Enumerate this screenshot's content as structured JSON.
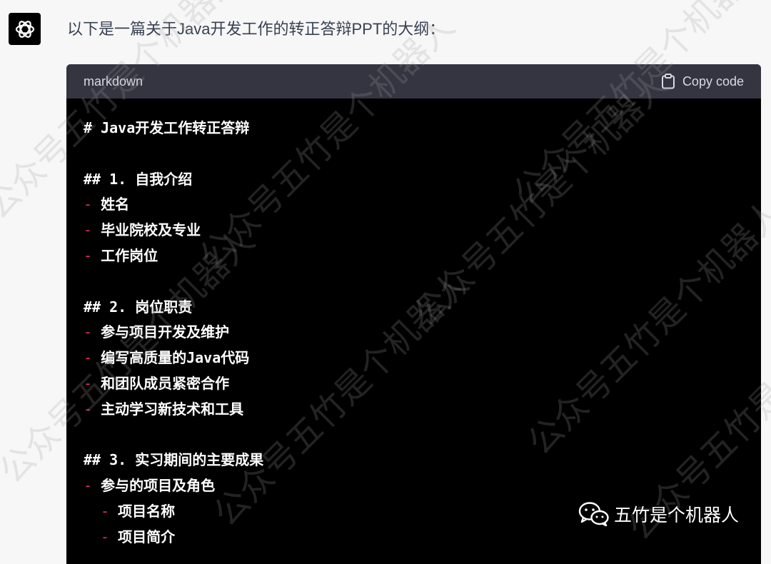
{
  "message": {
    "intro": "以下是一篇关于Java开发工作的转正答辩PPT的大纲："
  },
  "code_block": {
    "language": "markdown",
    "copy_label": "Copy code",
    "lines": [
      {
        "bullet": "",
        "indent": 0,
        "text": "# Java开发工作转正答辩"
      },
      {
        "bullet": "",
        "indent": 0,
        "text": ""
      },
      {
        "bullet": "",
        "indent": 0,
        "text": "## 1. 自我介绍"
      },
      {
        "bullet": "-",
        "indent": 0,
        "text": "姓名"
      },
      {
        "bullet": "-",
        "indent": 0,
        "text": "毕业院校及专业"
      },
      {
        "bullet": "-",
        "indent": 0,
        "text": "工作岗位"
      },
      {
        "bullet": "",
        "indent": 0,
        "text": ""
      },
      {
        "bullet": "",
        "indent": 0,
        "text": "## 2. 岗位职责"
      },
      {
        "bullet": "-",
        "indent": 0,
        "text": "参与项目开发及维护"
      },
      {
        "bullet": "-",
        "indent": 0,
        "text": "编写高质量的Java代码"
      },
      {
        "bullet": "-",
        "indent": 0,
        "text": "和团队成员紧密合作"
      },
      {
        "bullet": "-",
        "indent": 0,
        "text": "主动学习新技术和工具"
      },
      {
        "bullet": "",
        "indent": 0,
        "text": ""
      },
      {
        "bullet": "",
        "indent": 0,
        "text": "## 3. 实习期间的主要成果"
      },
      {
        "bullet": "-",
        "indent": 0,
        "text": "参与的项目及角色"
      },
      {
        "bullet": "-",
        "indent": 1,
        "text": "项目名称"
      },
      {
        "bullet": "-",
        "indent": 1,
        "text": "项目简介"
      }
    ]
  },
  "watermark": {
    "text": "公众号五竹是个机器人",
    "brand_name": "五竹是个机器人",
    "brand_icon": "wechat-icon"
  },
  "colors": {
    "background": "#f7f7f8",
    "code_background": "#000000",
    "code_header": "#343541",
    "bullet": "#df3079"
  }
}
